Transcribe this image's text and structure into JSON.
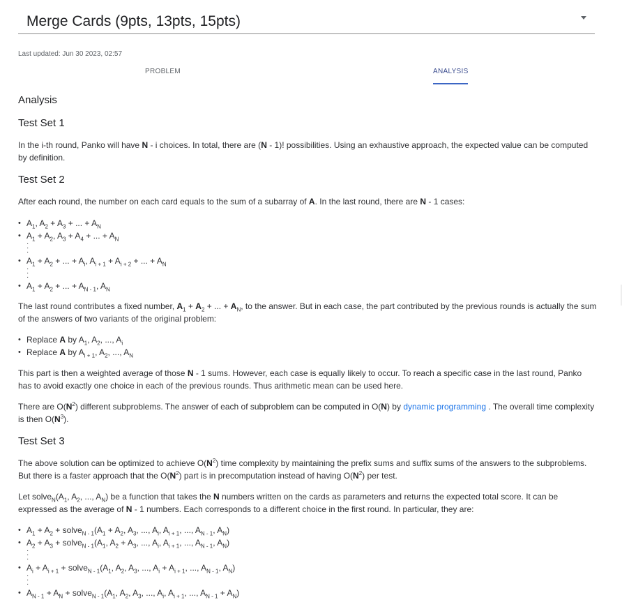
{
  "header": {
    "title": "Merge Cards (9pts, 13pts, 15pts)"
  },
  "last_updated": "Last updated: Jun 30 2023, 02:57",
  "tabs": {
    "problem": "PROBLEM",
    "analysis": "ANALYSIS"
  },
  "headings": {
    "analysis": "Analysis",
    "ts1": "Test Set 1",
    "ts2": "Test Set 2",
    "ts3": "Test Set 3"
  },
  "link": "dynamic programming",
  "colors": {
    "link": "#1a73e8",
    "tab_active_underline": "#3c66c4"
  }
}
